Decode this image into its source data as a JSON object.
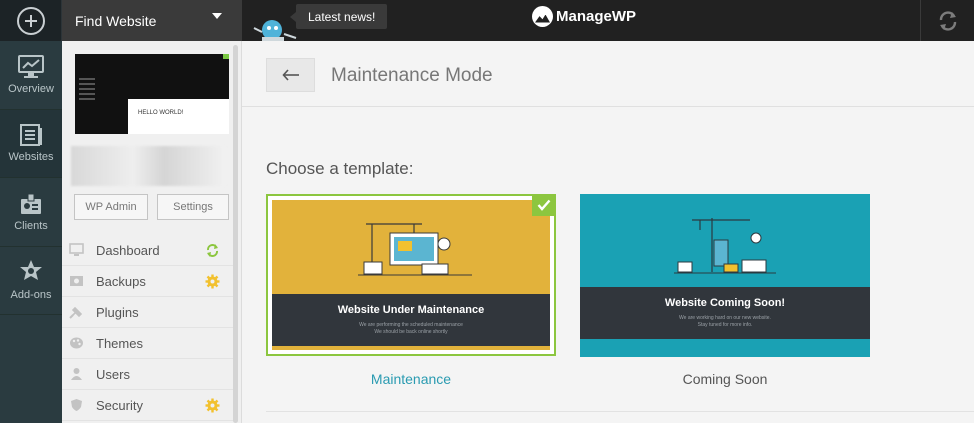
{
  "topbar": {
    "find_website_label": "Find Website",
    "news_label": "Latest news!",
    "logo_text": "ManageWP"
  },
  "rail": {
    "items": [
      {
        "label": "Overview",
        "icon": "monitor-chart-icon"
      },
      {
        "label": "Websites",
        "icon": "websites-icon"
      },
      {
        "label": "Clients",
        "icon": "clients-icon"
      },
      {
        "label": "Add-ons",
        "icon": "addons-icon"
      }
    ]
  },
  "site": {
    "thumbnail_text": "HELLO WORLD!",
    "wp_admin_label": "WP Admin",
    "settings_label": "Settings",
    "menu": [
      {
        "label": "Dashboard",
        "status": "sync-green"
      },
      {
        "label": "Backups",
        "status": "gear-yellow"
      },
      {
        "label": "Plugins",
        "status": ""
      },
      {
        "label": "Themes",
        "status": ""
      },
      {
        "label": "Users",
        "status": ""
      },
      {
        "label": "Security",
        "status": "gear-yellow"
      }
    ]
  },
  "main": {
    "title": "Maintenance Mode",
    "choose_label": "Choose a template:",
    "templates": [
      {
        "heading": "Website Under Maintenance",
        "sub_line1": "We are performing the scheduled maintenance",
        "sub_line2": "We should be back online shortly",
        "caption": "Maintenance",
        "selected": true
      },
      {
        "heading": "Website Coming Soon!",
        "sub_line1": "We are working hard on our new website.",
        "sub_line2": "Stay tuned for more info.",
        "caption": "Coming Soon",
        "selected": false
      }
    ]
  },
  "colors": {
    "rail_bg": "#2a3b40",
    "topbar_bg": "#212121",
    "selected_border": "#8cc63f",
    "maintenance_bg": "#e2b23b",
    "coming_soon_bg": "#1aa1b4",
    "link": "#2a9bb1"
  }
}
